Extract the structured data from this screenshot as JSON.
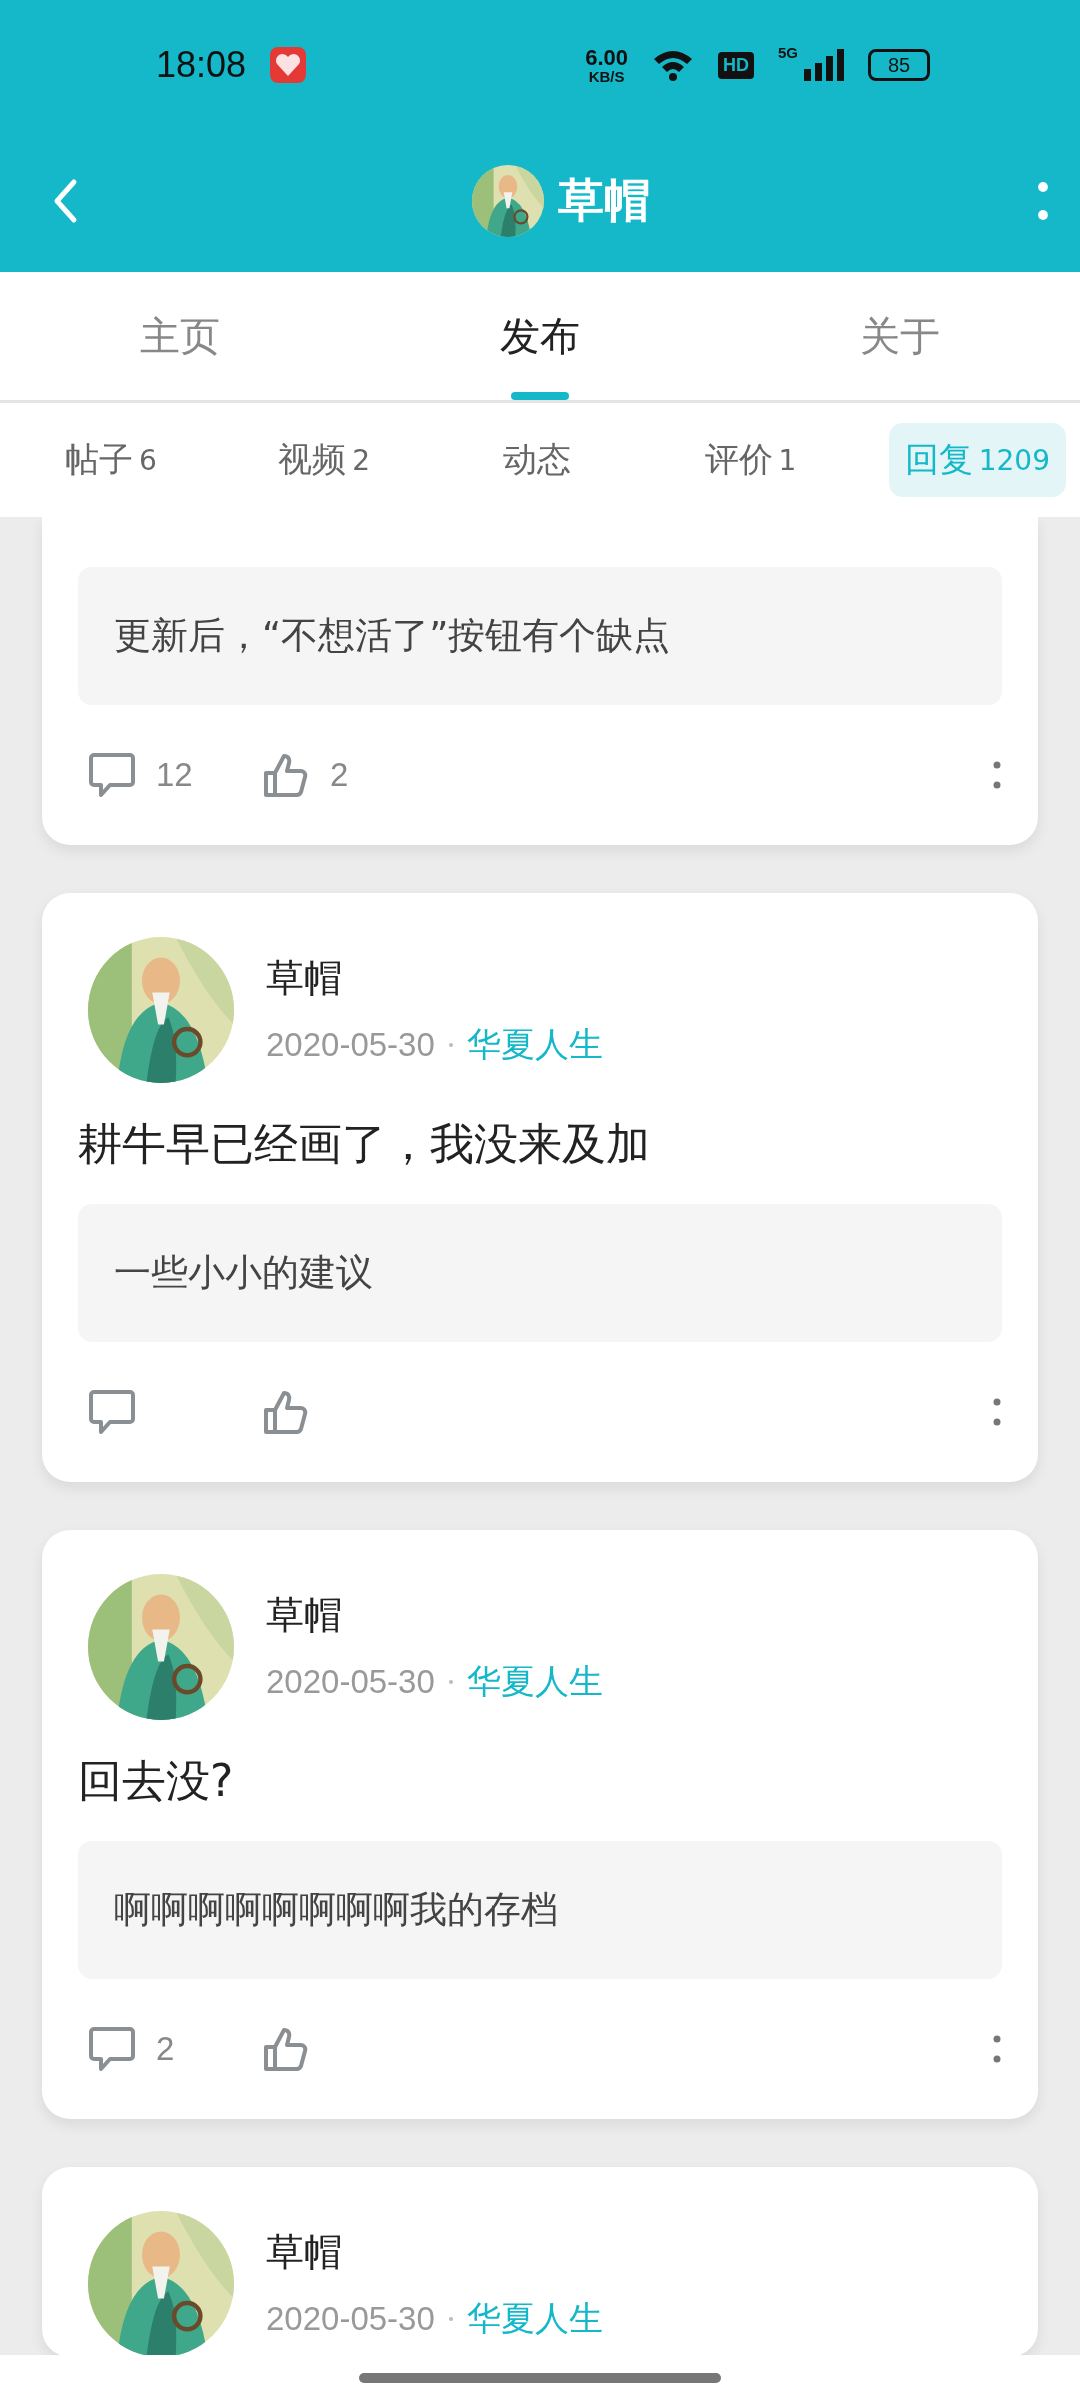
{
  "status_bar": {
    "time": "18:08",
    "net_speed": "6.00",
    "net_unit": "KB/S",
    "hd": "HD",
    "network": "5G",
    "battery": "85"
  },
  "header": {
    "title": "草帽"
  },
  "tabs": [
    {
      "label": "主页",
      "selected": false
    },
    {
      "label": "发布",
      "selected": true
    },
    {
      "label": "关于",
      "selected": false
    }
  ],
  "sub_tabs": [
    {
      "label": "帖子",
      "count": "6",
      "selected": false
    },
    {
      "label": "视频",
      "count": "2",
      "selected": false
    },
    {
      "label": "动态",
      "selected": false
    },
    {
      "label": "评价",
      "count": "1",
      "selected": false
    },
    {
      "label": "回复",
      "count": "1209",
      "selected": true
    }
  ],
  "posts": [
    {
      "quote": "更新后，“不想活了”按钮有个缺点",
      "comments": "12",
      "likes": "2"
    },
    {
      "author": "草帽",
      "date": "2020-05-30",
      "topic": "华夏人生",
      "text": "耕牛早已经画了，我没来及加",
      "quote": "一些小小的建议"
    },
    {
      "author": "草帽",
      "date": "2020-05-30",
      "topic": "华夏人生",
      "text": "回去没?",
      "quote": "啊啊啊啊啊啊啊啊我的存档",
      "comments": "2"
    },
    {
      "author": "草帽",
      "date": "2020-05-30",
      "topic": "华夏人生"
    }
  ]
}
